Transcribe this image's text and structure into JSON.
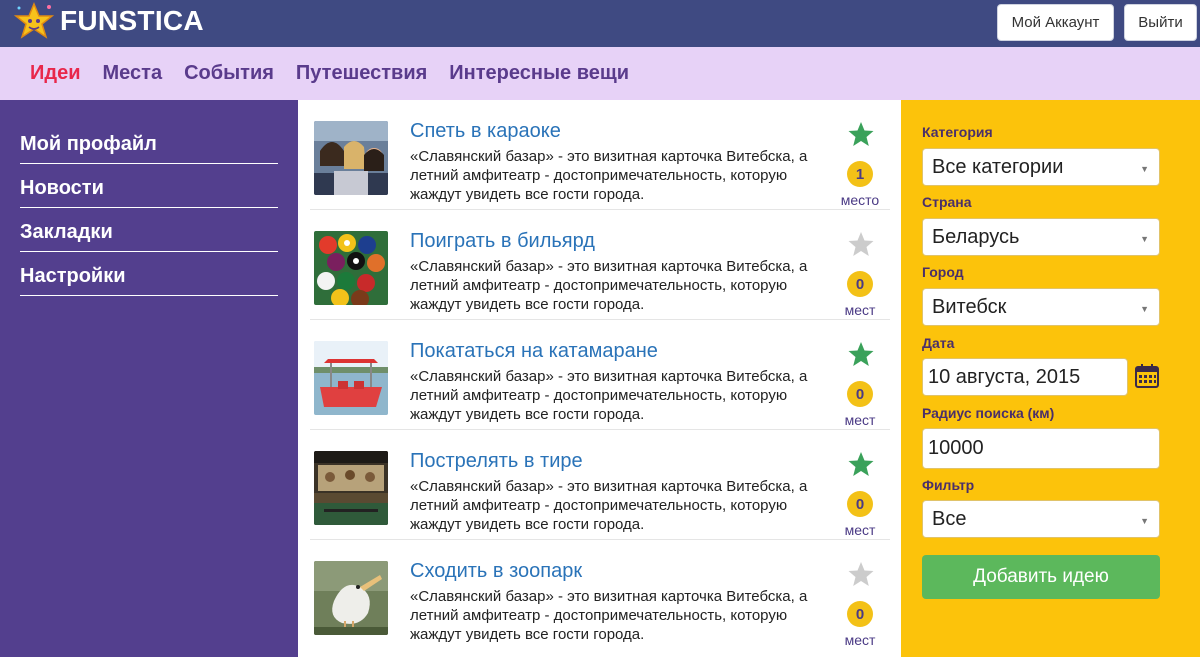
{
  "app": {
    "name": "FUNSTICA"
  },
  "header": {
    "account_label": "Мой Аккаунт",
    "logout_label": "Выйти"
  },
  "nav": {
    "items": [
      {
        "label": "Идеи",
        "active": true
      },
      {
        "label": "Места"
      },
      {
        "label": "События"
      },
      {
        "label": "Путешествия"
      },
      {
        "label": "Интересные вещи"
      }
    ]
  },
  "sidebar": {
    "items": [
      {
        "label": "Мой профайл"
      },
      {
        "label": "Новости"
      },
      {
        "label": "Закладки"
      },
      {
        "label": "Настройки"
      }
    ]
  },
  "ideas": [
    {
      "title": "Спеть в караоке",
      "desc": "«Славянский базар» - это визитная карточка Витебска, а летний амфитеатр - достопримечательность, которую жаждут увидеть все гости города.",
      "starred": true,
      "count": "1",
      "count_label": "место",
      "thumb_icon": "karaoke-photo"
    },
    {
      "title": "Поиграть в бильярд",
      "desc": "«Славянский базар» - это визитная карточка Витебска, а летний амфитеатр - достопримечательность, которую жаждут увидеть все гости города.",
      "starred": false,
      "count": "0",
      "count_label": "мест",
      "thumb_icon": "billiard-photo"
    },
    {
      "title": "Покататься на катамаране",
      "desc": "«Славянский базар» - это визитная карточка Витебска, а летний амфитеатр - достопримечательность, которую жаждут увидеть все гости города.",
      "starred": true,
      "count": "0",
      "count_label": "мест",
      "thumb_icon": "catamaran-photo"
    },
    {
      "title": "Пострелять в тире",
      "desc": "«Славянский базар» - это визитная карточка Витебска, а летний амфитеатр - достопримечательность, которую жаждут увидеть все гости города.",
      "starred": true,
      "count": "0",
      "count_label": "мест",
      "thumb_icon": "shooting-range-photo"
    },
    {
      "title": "Сходить в зоопарк",
      "desc": "«Славянский базар» - это визитная карточка Витебска, а летний амфитеатр - достопримечательность, которую жаждут увидеть все гости города.",
      "starred": false,
      "count": "0",
      "count_label": "мест",
      "thumb_icon": "zoo-photo"
    }
  ],
  "filters": {
    "category_label": "Категория",
    "category_value": "Все категории",
    "country_label": "Страна",
    "country_value": "Беларусь",
    "city_label": "Город",
    "city_value": "Витебск",
    "date_label": "Дата",
    "date_value": "10 августа, 2015",
    "radius_label": "Радиус поиска (км)",
    "radius_value": "10000",
    "filter_label": "Фильтр",
    "filter_value": "Все",
    "add_button_label": "Добавить идею"
  },
  "colors": {
    "topbar": "#3f4a82",
    "nav_bg": "#e7d2f7",
    "sidebar": "#533f8e",
    "panel": "#fcc30b",
    "accent_active": "#e8274b",
    "star_on": "#3aa15a",
    "star_off": "#cccccc",
    "badge": "#f3c117",
    "add_button": "#5cb85c"
  }
}
